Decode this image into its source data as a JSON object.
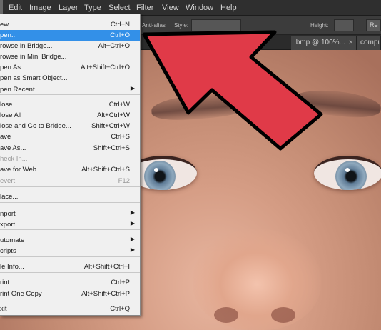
{
  "menubar": {
    "items": [
      "Edit",
      "Image",
      "Layer",
      "Type",
      "Select",
      "Filter",
      "View",
      "Window",
      "Help"
    ]
  },
  "options_bar": {
    "antialias_label": "Anti-alias",
    "style_label": "Style:",
    "height_label": "Height:",
    "refine_button": "Re"
  },
  "tabs": [
    {
      "label": ".bmp @ 100%...",
      "close": "×"
    },
    {
      "label": "compute",
      "close": ""
    }
  ],
  "file_menu": {
    "items": [
      {
        "label": "ew...",
        "shortcut": "Ctrl+N"
      },
      {
        "label": "pen...",
        "shortcut": "Ctrl+O",
        "highlighted": true
      },
      {
        "label": "rowse in Bridge...",
        "shortcut": "Alt+Ctrl+O"
      },
      {
        "label": "rowse in Mini Bridge...",
        "shortcut": ""
      },
      {
        "label": "pen As...",
        "shortcut": "Alt+Shift+Ctrl+O"
      },
      {
        "label": "pen as Smart Object...",
        "shortcut": ""
      },
      {
        "label": "pen Recent",
        "shortcut": "",
        "submenu": true
      },
      {
        "label": "lose",
        "shortcut": "Ctrl+W"
      },
      {
        "label": "lose All",
        "shortcut": "Alt+Ctrl+W"
      },
      {
        "label": "lose and Go to Bridge...",
        "shortcut": "Shift+Ctrl+W"
      },
      {
        "label": "ave",
        "shortcut": "Ctrl+S"
      },
      {
        "label": "ave As...",
        "shortcut": "Shift+Ctrl+S"
      },
      {
        "label": "heck In...",
        "shortcut": "",
        "disabled": true
      },
      {
        "label": "ave for Web...",
        "shortcut": "Alt+Shift+Ctrl+S"
      },
      {
        "label": "evert",
        "shortcut": "F12",
        "disabled": true
      },
      {
        "label": "lace...",
        "shortcut": ""
      },
      {
        "label": "nport",
        "shortcut": "",
        "submenu": true
      },
      {
        "label": "xport",
        "shortcut": "",
        "submenu": true
      },
      {
        "label": "utomate",
        "shortcut": "",
        "submenu": true
      },
      {
        "label": "cripts",
        "shortcut": "",
        "submenu": true
      },
      {
        "label": "le Info...",
        "shortcut": "Alt+Shift+Ctrl+I"
      },
      {
        "label": "rint...",
        "shortcut": "Ctrl+P"
      },
      {
        "label": "rint One Copy",
        "shortcut": "Alt+Shift+Ctrl+P"
      },
      {
        "label": "xit",
        "shortcut": "Ctrl+Q"
      }
    ],
    "submenu_icon": "chevron-right-icon",
    "submenu_glyph": "▶"
  },
  "colors": {
    "menu_highlight": "#3390e8",
    "arrow_fill": "#e03a48",
    "arrow_outline": "#000000",
    "menubar_bg": "#2f2f2f"
  }
}
